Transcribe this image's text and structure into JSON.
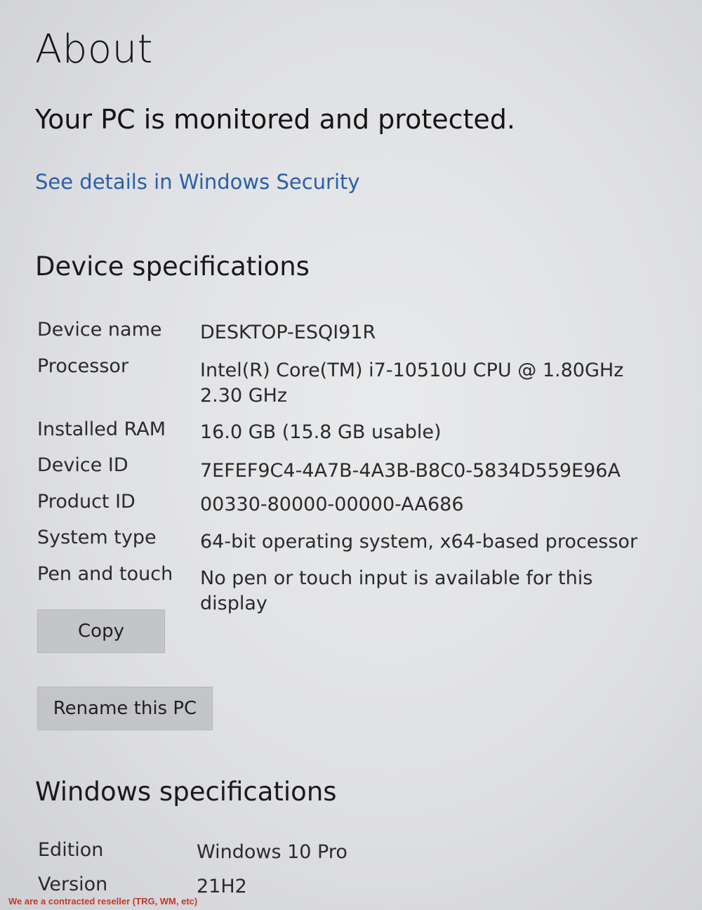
{
  "page": {
    "title": "About",
    "protection_message": "Your PC is monitored and protected.",
    "security_link": "See details in Windows Security"
  },
  "device_specs": {
    "heading": "Device specifications",
    "rows": [
      {
        "label": "Device name",
        "value": "DESKTOP-ESQI91R"
      },
      {
        "label": "Processor",
        "value": "Intel(R) Core(TM) i7-10510U CPU @ 1.80GHz   2.30 GHz"
      },
      {
        "label": "Installed RAM",
        "value": "16.0 GB (15.8 GB usable)"
      },
      {
        "label": "Device ID",
        "value": "7EFEF9C4-4A7B-4A3B-B8C0-5834D559E96A"
      },
      {
        "label": "Product ID",
        "value": "00330-80000-00000-AA686"
      },
      {
        "label": "System type",
        "value": "64-bit operating system, x64-based processor"
      },
      {
        "label": "Pen and touch",
        "value": "No pen or touch input is available for this display"
      }
    ],
    "copy_button": "Copy",
    "rename_button": "Rename this PC"
  },
  "windows_specs": {
    "heading": "Windows specifications",
    "rows": [
      {
        "label": "Edition",
        "value": "Windows 10 Pro"
      },
      {
        "label": "Version",
        "value": "21H2"
      }
    ]
  },
  "watermark": "We are a contracted reseller (TRG, WM, etc)"
}
